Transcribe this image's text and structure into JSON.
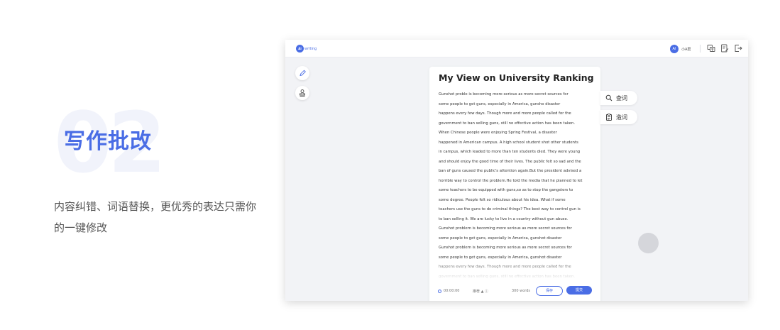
{
  "promo": {
    "number": "02",
    "title": "写作批改",
    "description": "内容纠错、词语替换，更优秀的表达只需你的一键修改"
  },
  "app": {
    "logo": {
      "badge": "Ai",
      "text": "writing"
    },
    "user": {
      "avatar": "AI",
      "name": "小A君"
    },
    "topbar_icons": [
      "translate-icon",
      "edit-document-icon",
      "logout-icon"
    ],
    "tools": [
      "pen-icon",
      "stamp-icon"
    ],
    "document": {
      "title": "My View on University Ranking",
      "lines": [
        "Gunshot proble is becoming more serious as more secret sources for",
        "some people to get guns, especially in America, gunsho disaster",
        "happens every few days. Though more and more people called for the",
        "government to ban selling guns, still no effective action has been taken.",
        "When Chinese people were enjoying Spring Festival, a disaster",
        "happened in American campus. A high school student shot other students",
        "in campus, which leaded to more than ten students died. They were young",
        "and should enjoy the good time of their lives. The public felt so sad and the",
        "ban of guns caused the public's attention again.But the president advised a",
        "horrible way to control the problem.He told the media that he planned to let",
        "some teachers to be equipped with guns,so as to stop the gangsters to",
        "some degree. People felt so ridiculous about his idea. What if some",
        "teachers use the guns to do criminal things? The best way to control gun is",
        "to ban selling it. We are lucky to live in a country without gun abuse.",
        "Gunshot problem is becoming more serious as more secret sources for",
        "some people to get guns, especially in America, gunshot disaster",
        "Gunshot problem is becoming more serious as more secret sources for",
        "some people to get guns, especially in America, gunshot disaster",
        "happens every few days. Though more and more people called for the",
        "government to ban selling guns, still no effective action has been taken."
      ],
      "timer": "00:00:00",
      "recorder": "推荐 ▲ ⓘ",
      "word_count": "300 words",
      "save_label": "保存",
      "submit_label": "提交"
    },
    "side_tabs": [
      {
        "icon": "search-icon",
        "label": "查词"
      },
      {
        "icon": "clipboard-icon",
        "label": "造词"
      }
    ]
  },
  "colors": {
    "accent": "#4a6de5",
    "app_bg": "#f2f3f6",
    "watermark": "#f1f3fb"
  }
}
